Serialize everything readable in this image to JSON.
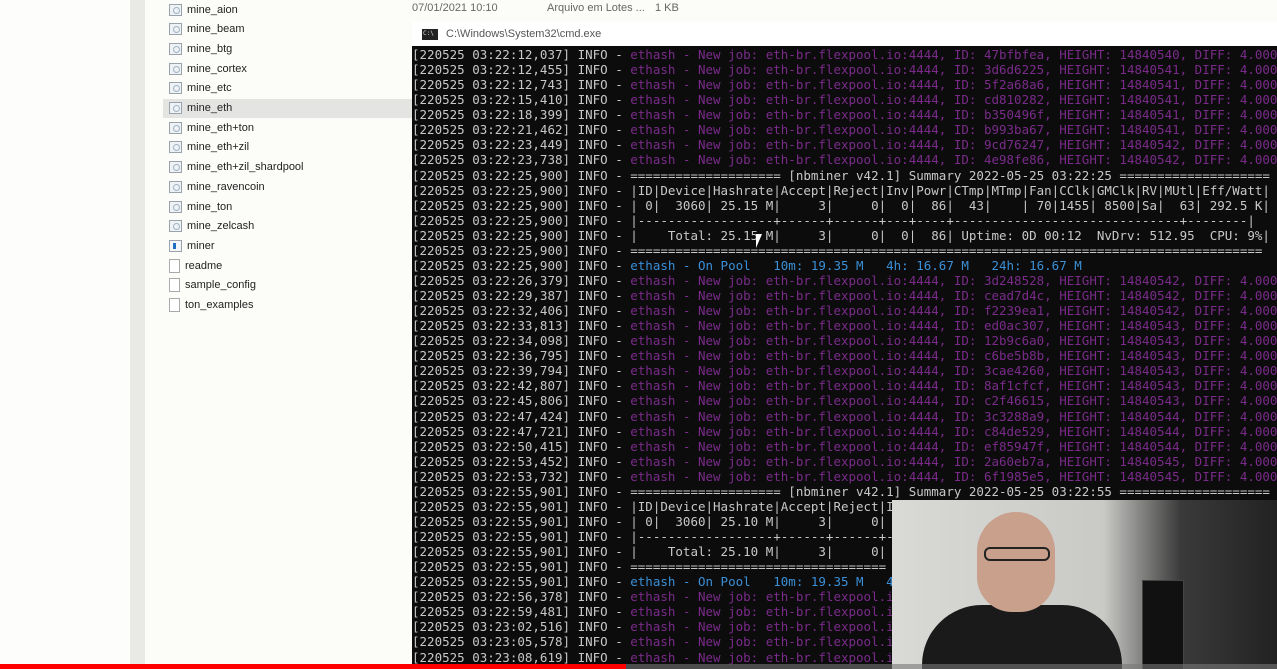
{
  "explorer": {
    "files": [
      {
        "name": "mine_aion",
        "type": "bat"
      },
      {
        "name": "mine_beam",
        "type": "bat"
      },
      {
        "name": "mine_btg",
        "type": "bat"
      },
      {
        "name": "mine_cortex",
        "type": "bat"
      },
      {
        "name": "mine_etc",
        "type": "bat"
      },
      {
        "name": "mine_eth",
        "type": "bat",
        "selected": true
      },
      {
        "name": "mine_eth+ton",
        "type": "bat"
      },
      {
        "name": "mine_eth+zil",
        "type": "bat"
      },
      {
        "name": "mine_eth+zil_shardpool",
        "type": "bat"
      },
      {
        "name": "mine_ravencoin",
        "type": "bat"
      },
      {
        "name": "mine_ton",
        "type": "bat"
      },
      {
        "name": "mine_zelcash",
        "type": "bat"
      },
      {
        "name": "miner",
        "type": "exe"
      },
      {
        "name": "readme",
        "type": "txt"
      },
      {
        "name": "sample_config",
        "type": "txt"
      },
      {
        "name": "ton_examples",
        "type": "txt"
      }
    ],
    "first_row_details": {
      "date": "07/01/2021 10:10",
      "type": "Arquivo em Lotes ...",
      "size": "1 KB"
    }
  },
  "cmd": {
    "title": "C:\\Windows\\System32\\cmd.exe",
    "lines": [
      {
        "p": "[220525 03:22:12,037] INFO - ",
        "t": "ethash - New job: eth-br.flexpool.io:4444, ID: 47bfbfea, HEIGHT: 14840540, DIFF: 4.000",
        "k": "job"
      },
      {
        "p": "[220525 03:22:12,455] INFO - ",
        "t": "ethash - New job: eth-br.flexpool.io:4444, ID: 3d6d6225, HEIGHT: 14840541, DIFF: 4.000",
        "k": "job"
      },
      {
        "p": "[220525 03:22:12,743] INFO - ",
        "t": "ethash - New job: eth-br.flexpool.io:4444, ID: 5f2a68a6, HEIGHT: 14840541, DIFF: 4.000",
        "k": "job"
      },
      {
        "p": "[220525 03:22:15,410] INFO - ",
        "t": "ethash - New job: eth-br.flexpool.io:4444, ID: cd810282, HEIGHT: 14840541, DIFF: 4.000",
        "k": "job"
      },
      {
        "p": "[220525 03:22:18,399] INFO - ",
        "t": "ethash - New job: eth-br.flexpool.io:4444, ID: b350496f, HEIGHT: 14840541, DIFF: 4.000",
        "k": "job"
      },
      {
        "p": "[220525 03:22:21,462] INFO - ",
        "t": "ethash - New job: eth-br.flexpool.io:4444, ID: b993ba67, HEIGHT: 14840541, DIFF: 4.000",
        "k": "job"
      },
      {
        "p": "[220525 03:22:23,449] INFO - ",
        "t": "ethash - New job: eth-br.flexpool.io:4444, ID: 9cd76247, HEIGHT: 14840542, DIFF: 4.000",
        "k": "job"
      },
      {
        "p": "[220525 03:22:23,738] INFO - ",
        "t": "ethash - New job: eth-br.flexpool.io:4444, ID: 4e98fe86, HEIGHT: 14840542, DIFF: 4.000",
        "k": "job"
      },
      {
        "p": "[220525 03:22:25,900] INFO - ",
        "t": "==================== [nbminer v42.1] Summary 2022-05-25 03:22:25 ====================",
        "k": "sum"
      },
      {
        "p": "[220525 03:22:25,900] INFO - ",
        "t": "|ID|Device|Hashrate|Accept|Reject|Inv|Powr|CTmp|MTmp|Fan|CClk|GMClk|RV|MUtl|Eff/Watt|",
        "k": "sum"
      },
      {
        "p": "[220525 03:22:25,900] INFO - ",
        "t": "| 0|  3060| 25.15 M|     3|     0|  0|  86|  43|    | 70|1455| 8500|Sa|  63| 292.5 K|",
        "k": "sum"
      },
      {
        "p": "[220525 03:22:25,900] INFO - ",
        "t": "|------------------+------+------+---+----+------------------------------+--------|",
        "k": "sum"
      },
      {
        "p": "[220525 03:22:25,900] INFO - ",
        "t": "|    Total: 25.15 M|     3|     0|  0|  86| Uptime: 0D 00:12  NvDrv: 512.95  CPU: 9%|",
        "k": "sum"
      },
      {
        "p": "[220525 03:22:25,900] INFO - ",
        "t": "====================================================================================",
        "k": "sum"
      },
      {
        "p": "[220525 03:22:25,900] INFO - ",
        "t": "ethash - On Pool   10m: 19.35 M   4h: 16.67 M   24h: 16.67 M",
        "k": "pool"
      },
      {
        "p": "[220525 03:22:26,379] INFO - ",
        "t": "ethash - New job: eth-br.flexpool.io:4444, ID: 3d248528, HEIGHT: 14840542, DIFF: 4.000",
        "k": "job"
      },
      {
        "p": "[220525 03:22:29,387] INFO - ",
        "t": "ethash - New job: eth-br.flexpool.io:4444, ID: cead7d4c, HEIGHT: 14840542, DIFF: 4.000",
        "k": "job"
      },
      {
        "p": "[220525 03:22:32,406] INFO - ",
        "t": "ethash - New job: eth-br.flexpool.io:4444, ID: f2239ea1, HEIGHT: 14840542, DIFF: 4.000",
        "k": "job"
      },
      {
        "p": "[220525 03:22:33,813] INFO - ",
        "t": "ethash - New job: eth-br.flexpool.io:4444, ID: ed0ac307, HEIGHT: 14840543, DIFF: 4.000",
        "k": "job"
      },
      {
        "p": "[220525 03:22:34,098] INFO - ",
        "t": "ethash - New job: eth-br.flexpool.io:4444, ID: 12b9c6a0, HEIGHT: 14840543, DIFF: 4.000",
        "k": "job"
      },
      {
        "p": "[220525 03:22:36,795] INFO - ",
        "t": "ethash - New job: eth-br.flexpool.io:4444, ID: c6be5b8b, HEIGHT: 14840543, DIFF: 4.000",
        "k": "job"
      },
      {
        "p": "[220525 03:22:39,794] INFO - ",
        "t": "ethash - New job: eth-br.flexpool.io:4444, ID: 3cae4260, HEIGHT: 14840543, DIFF: 4.000",
        "k": "job"
      },
      {
        "p": "[220525 03:22:42,807] INFO - ",
        "t": "ethash - New job: eth-br.flexpool.io:4444, ID: 8af1cfcf, HEIGHT: 14840543, DIFF: 4.000",
        "k": "job"
      },
      {
        "p": "[220525 03:22:45,806] INFO - ",
        "t": "ethash - New job: eth-br.flexpool.io:4444, ID: c2f46615, HEIGHT: 14840543, DIFF: 4.000",
        "k": "job"
      },
      {
        "p": "[220525 03:22:47,424] INFO - ",
        "t": "ethash - New job: eth-br.flexpool.io:4444, ID: 3c3288a9, HEIGHT: 14840544, DIFF: 4.000",
        "k": "job"
      },
      {
        "p": "[220525 03:22:47,721] INFO - ",
        "t": "ethash - New job: eth-br.flexpool.io:4444, ID: c84de529, HEIGHT: 14840544, DIFF: 4.000",
        "k": "job"
      },
      {
        "p": "[220525 03:22:50,415] INFO - ",
        "t": "ethash - New job: eth-br.flexpool.io:4444, ID: ef85947f, HEIGHT: 14840544, DIFF: 4.000",
        "k": "job"
      },
      {
        "p": "[220525 03:22:53,452] INFO - ",
        "t": "ethash - New job: eth-br.flexpool.io:4444, ID: 2a60eb7a, HEIGHT: 14840545, DIFF: 4.000",
        "k": "job"
      },
      {
        "p": "[220525 03:22:53,732] INFO - ",
        "t": "ethash - New job: eth-br.flexpool.io:4444, ID: 6f1985e5, HEIGHT: 14840545, DIFF: 4.000",
        "k": "job"
      },
      {
        "p": "[220525 03:22:55,901] INFO - ",
        "t": "==================== [nbminer v42.1] Summary 2022-05-25 03:22:55 ====================",
        "k": "sum"
      },
      {
        "p": "[220525 03:22:55,901] INFO - ",
        "t": "|ID|Device|Hashrate|Accept|Reject|I",
        "k": "sum"
      },
      {
        "p": "[220525 03:22:55,901] INFO - ",
        "t": "| 0|  3060| 25.10 M|     3|     0|",
        "k": "sum"
      },
      {
        "p": "[220525 03:22:55,901] INFO - ",
        "t": "|------------------+------+------+-",
        "k": "sum"
      },
      {
        "p": "[220525 03:22:55,901] INFO - ",
        "t": "|    Total: 25.10 M|     3|     0|",
        "k": "sum"
      },
      {
        "p": "[220525 03:22:55,901] INFO - ",
        "t": "==================================",
        "k": "sum"
      },
      {
        "p": "[220525 03:22:55,901] INFO - ",
        "t": "ethash - On Pool   10m: 19.35 M   4",
        "k": "pool"
      },
      {
        "p": "[220525 03:22:56,378] INFO - ",
        "t": "ethash - New job: eth-br.flexpool.i",
        "k": "job"
      },
      {
        "p": "[220525 03:22:59,481] INFO - ",
        "t": "ethash - New job: eth-br.flexpool.i",
        "k": "job"
      },
      {
        "p": "[220525 03:23:02,516] INFO - ",
        "t": "ethash - New job: eth-br.flexpool.i",
        "k": "job"
      },
      {
        "p": "[220525 03:23:05,578] INFO - ",
        "t": "ethash - New job: eth-br.flexpool.i",
        "k": "job"
      },
      {
        "p": "[220525 03:23:08,619] INFO - ",
        "t": "ethash - New job: eth-br.flexpool.i",
        "k": "job"
      }
    ]
  },
  "colors": {
    "terminal_bg": "#0c0c0c",
    "job_text": "#7a2b8a",
    "pool_text": "#3a8fd6",
    "prefix_text": "#c8c8c8",
    "progress": "#ff0000"
  },
  "video": {
    "progress_fraction": 0.49
  }
}
